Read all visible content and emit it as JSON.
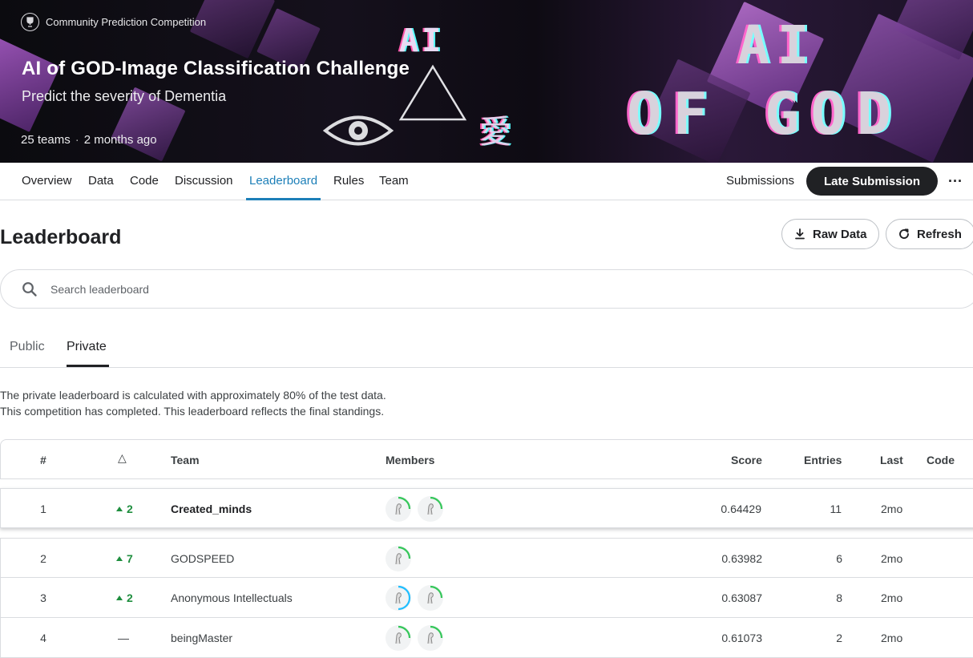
{
  "banner": {
    "badge_text": "Community Prediction Competition",
    "title": "AI of GOD-Image Classification Challenge",
    "subtitle": "Predict the severity of Dementia",
    "teams": "25 teams",
    "separator": "·",
    "time_ago": "2 months ago",
    "deco_ai_small": "AI",
    "deco_love": "愛",
    "deco_big_ai": "AI",
    "deco_big_god": "OF GOD"
  },
  "nav": {
    "tabs": [
      "Overview",
      "Data",
      "Code",
      "Discussion",
      "Leaderboard",
      "Rules",
      "Team"
    ],
    "active_tab": "Leaderboard",
    "submissions": "Submissions",
    "late_submission": "Late Submission",
    "more": "···"
  },
  "leaderboard": {
    "title": "Leaderboard",
    "raw_data": "Raw Data",
    "refresh": "Refresh",
    "search_placeholder": "Search leaderboard",
    "sub_tabs": [
      "Public",
      "Private"
    ],
    "active_sub_tab": "Private",
    "note_1": "The private leaderboard is calculated with approximately 80% of the test data.",
    "note_2": "This competition has completed. This leaderboard reflects the final standings."
  },
  "table": {
    "headers": {
      "rank": "#",
      "delta": "△",
      "team": "Team",
      "members": "Members",
      "score": "Score",
      "entries": "Entries",
      "last": "Last",
      "code": "Code"
    },
    "rows": [
      {
        "rank": "1",
        "delta": "2",
        "delta_dir": "up",
        "team": "Created_minds",
        "member_count": 2,
        "score": "0.64429",
        "entries": "11",
        "last": "2mo"
      },
      {
        "rank": "2",
        "delta": "7",
        "delta_dir": "up",
        "team": "GODSPEED",
        "member_count": 1,
        "score": "0.63982",
        "entries": "6",
        "last": "2mo"
      },
      {
        "rank": "3",
        "delta": "2",
        "delta_dir": "up",
        "team": "Anonymous Intellectuals",
        "member_count": 2,
        "score": "0.63087",
        "entries": "8",
        "last": "2mo"
      },
      {
        "rank": "4",
        "delta": "—",
        "delta_dir": "none",
        "team": "beingMaster",
        "member_count": 2,
        "score": "0.61073",
        "entries": "2",
        "last": "2mo"
      }
    ]
  },
  "colors": {
    "accent": "#1c7fb8",
    "up_green": "#1e8e3e",
    "avatar_ring_green": "#34c759",
    "avatar_ring_blue": "#20beff"
  }
}
